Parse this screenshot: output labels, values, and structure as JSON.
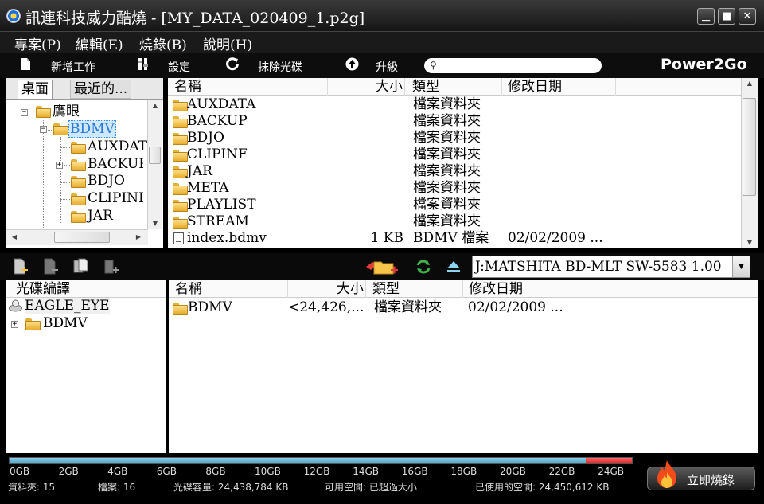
{
  "window": {
    "title": "訊連科技威力酷燒 - [MY_DATA_020409_1.p2g]",
    "minimize": "▁",
    "maximize": "■",
    "close": "✕"
  },
  "menu": [
    "專案(P)",
    "編輯(E)",
    "燒錄(B)",
    "說明(H)"
  ],
  "toolbar": {
    "new_task": "新增工作",
    "settings": "設定",
    "erase_disc": "抹除光碟",
    "upgrade": "升級",
    "search_placeholder": "",
    "brand": "Power2Go"
  },
  "source_tree": {
    "tabs": [
      "桌面",
      "最近的..."
    ],
    "active_tab": 0,
    "nodes": [
      {
        "label": "鷹眼",
        "expander": "−"
      },
      {
        "label": "BDMV",
        "expander": "−",
        "selected": true
      },
      {
        "label": "AUXDATA"
      },
      {
        "label": "BACKUP",
        "expander": "+"
      },
      {
        "label": "BDJO"
      },
      {
        "label": "CLIPINF"
      },
      {
        "label": "JAR"
      }
    ]
  },
  "source_list": {
    "columns": [
      "名稱",
      "大小",
      "類型",
      "修改日期"
    ],
    "rows": [
      {
        "name": "AUXDATA",
        "size": "",
        "type": "檔案資料夾",
        "date": "",
        "icon": "folder-icon"
      },
      {
        "name": "BACKUP",
        "size": "",
        "type": "檔案資料夾",
        "date": "",
        "icon": "folder-icon"
      },
      {
        "name": "BDJO",
        "size": "",
        "type": "檔案資料夾",
        "date": "",
        "icon": "folder-icon"
      },
      {
        "name": "CLIPINF",
        "size": "",
        "type": "檔案資料夾",
        "date": "",
        "icon": "folder-icon"
      },
      {
        "name": "JAR",
        "size": "",
        "type": "檔案資料夾",
        "date": "",
        "icon": "folder-icon"
      },
      {
        "name": "META",
        "size": "",
        "type": "檔案資料夾",
        "date": "",
        "icon": "folder-icon"
      },
      {
        "name": "PLAYLIST",
        "size": "",
        "type": "檔案資料夾",
        "date": "",
        "icon": "folder-icon"
      },
      {
        "name": "STREAM",
        "size": "",
        "type": "檔案資料夾",
        "date": "",
        "icon": "folder-icon"
      },
      {
        "name": "index.bdmv",
        "size": "1 KB",
        "type": "BDMV 檔案",
        "date": "02/02/2009 ...",
        "icon": "file-icon"
      }
    ]
  },
  "drive": {
    "selected": "J:MATSHITA BD-MLT SW-5583 1.00"
  },
  "disc_tree": {
    "header": "光碟編譯",
    "root": "EAGLE_EYE",
    "children": [
      {
        "label": "BDMV",
        "expander": "+"
      }
    ]
  },
  "disc_list": {
    "columns": [
      "名稱",
      "大小",
      "類型",
      "修改日期"
    ],
    "rows": [
      {
        "name": "BDMV",
        "size": "<24,426,...",
        "type": "檔案資料夾",
        "date": "02/02/2009 ..."
      }
    ]
  },
  "capacity": {
    "scale": [
      "0GB",
      "2GB",
      "4GB",
      "6GB",
      "8GB",
      "10GB",
      "12GB",
      "14GB",
      "16GB",
      "18GB",
      "20GB",
      "22GB",
      "24GB"
    ],
    "used_fraction": 0.926,
    "over_fraction": 0.074
  },
  "status": {
    "folders": "資料夾: 15",
    "files": "檔案: 16",
    "disc_capacity": "光碟容量: 24,438,784 KB",
    "free_space": "可用空間: 已超過大小",
    "used_space": "已使用的空間: 24,450,612 KB"
  },
  "burn_button": "立即燒錄",
  "colors": {
    "capacity_fill": "#4aa5c9",
    "capacity_over": "#d22222",
    "selection": "#cde8ff"
  }
}
